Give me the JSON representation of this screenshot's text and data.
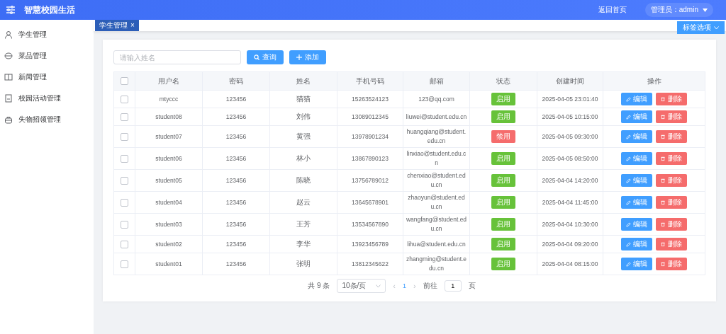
{
  "header": {
    "title": "智慧校园生活",
    "links": [
      {
        "label": "返回首页"
      }
    ],
    "user_menu": {
      "label": "管理员：admin"
    }
  },
  "sidebar": {
    "items": [
      {
        "label": "学生管理",
        "selected": false
      },
      {
        "label": "菜品管理",
        "selected": false
      },
      {
        "label": "新闻管理",
        "selected": false
      },
      {
        "label": "校园活动管理",
        "selected": false
      },
      {
        "label": "失物招领管理",
        "selected": false
      }
    ]
  },
  "tabs": [
    {
      "label": "学生管理",
      "close": "×",
      "selected": true
    }
  ],
  "tab_options": {
    "label": "标签选项"
  },
  "search": {
    "placeholder": "请输入姓名",
    "buttons": [
      {
        "label": "查询",
        "kind": "search"
      },
      {
        "label": "添加",
        "kind": "add"
      }
    ]
  },
  "table": {
    "header_checked": false,
    "columns": [
      "用户名",
      "密码",
      "姓名",
      "手机号码",
      "邮箱",
      "状态",
      "创建时间",
      "操作"
    ],
    "rows": [
      {
        "checked": false,
        "username": "mtyccc",
        "password": "123456",
        "name": "猫猫",
        "phone": "15263524123",
        "email": "123@qq.com",
        "status": {
          "label": "启用",
          "enabled": true
        },
        "created": "2025-04-05 23:01:40",
        "actions": [
          {
            "label": "编辑",
            "kind": "edit"
          },
          {
            "label": "删除",
            "kind": "delete"
          }
        ]
      },
      {
        "checked": false,
        "username": "student08",
        "password": "123456",
        "name": "刘伟",
        "phone": "13089012345",
        "email": "liuwei@student.edu.cn",
        "status": {
          "label": "启用",
          "enabled": true
        },
        "created": "2025-04-05 10:15:00",
        "actions": [
          {
            "label": "编辑",
            "kind": "edit"
          },
          {
            "label": "删除",
            "kind": "delete"
          }
        ]
      },
      {
        "checked": false,
        "username": "student07",
        "password": "123456",
        "name": "黄强",
        "phone": "13978901234",
        "email": "huangqiang@student.edu.cn",
        "status": {
          "label": "禁用",
          "enabled": false
        },
        "created": "2025-04-05 09:30:00",
        "actions": [
          {
            "label": "编辑",
            "kind": "edit"
          },
          {
            "label": "删除",
            "kind": "delete"
          }
        ]
      },
      {
        "checked": false,
        "username": "student06",
        "password": "123456",
        "name": "林小",
        "phone": "13867890123",
        "email": "linxiao@student.edu.cn",
        "status": {
          "label": "启用",
          "enabled": true
        },
        "created": "2025-04-05 08:50:00",
        "actions": [
          {
            "label": "编辑",
            "kind": "edit"
          },
          {
            "label": "删除",
            "kind": "delete"
          }
        ]
      },
      {
        "checked": false,
        "username": "student05",
        "password": "123456",
        "name": "陈晓",
        "phone": "13756789012",
        "email": "chenxiao@student.edu.cn",
        "status": {
          "label": "启用",
          "enabled": true
        },
        "created": "2025-04-04 14:20:00",
        "actions": [
          {
            "label": "编辑",
            "kind": "edit"
          },
          {
            "label": "删除",
            "kind": "delete"
          }
        ]
      },
      {
        "checked": false,
        "username": "student04",
        "password": "123456",
        "name": "赵云",
        "phone": "13645678901",
        "email": "zhaoyun@student.edu.cn",
        "status": {
          "label": "启用",
          "enabled": true
        },
        "created": "2025-04-04 11:45:00",
        "actions": [
          {
            "label": "编辑",
            "kind": "edit"
          },
          {
            "label": "删除",
            "kind": "delete"
          }
        ]
      },
      {
        "checked": false,
        "username": "student03",
        "password": "123456",
        "name": "王芳",
        "phone": "13534567890",
        "email": "wangfang@student.edu.cn",
        "status": {
          "label": "启用",
          "enabled": true
        },
        "created": "2025-04-04 10:30:00",
        "actions": [
          {
            "label": "编辑",
            "kind": "edit"
          },
          {
            "label": "删除",
            "kind": "delete"
          }
        ]
      },
      {
        "checked": false,
        "username": "student02",
        "password": "123456",
        "name": "李华",
        "phone": "13923456789",
        "email": "lihua@student.edu.cn",
        "status": {
          "label": "启用",
          "enabled": true
        },
        "created": "2025-04-04 09:20:00",
        "actions": [
          {
            "label": "编辑",
            "kind": "edit"
          },
          {
            "label": "删除",
            "kind": "delete"
          }
        ]
      },
      {
        "checked": false,
        "username": "student01",
        "password": "123456",
        "name": "张明",
        "phone": "13812345622",
        "email": "zhangming@student.edu.cn",
        "status": {
          "label": "启用",
          "enabled": true
        },
        "created": "2025-04-04 08:15:00",
        "actions": [
          {
            "label": "编辑",
            "kind": "edit"
          },
          {
            "label": "删除",
            "kind": "delete"
          }
        ]
      }
    ]
  },
  "pagination": {
    "total": "共 9 条",
    "page_size": "10条/页",
    "prev": "‹",
    "pages": [
      {
        "label": "1",
        "selected": true
      }
    ],
    "next": "›",
    "goto_label": "前往",
    "goto_value": "1",
    "goto_suffix": "页"
  }
}
